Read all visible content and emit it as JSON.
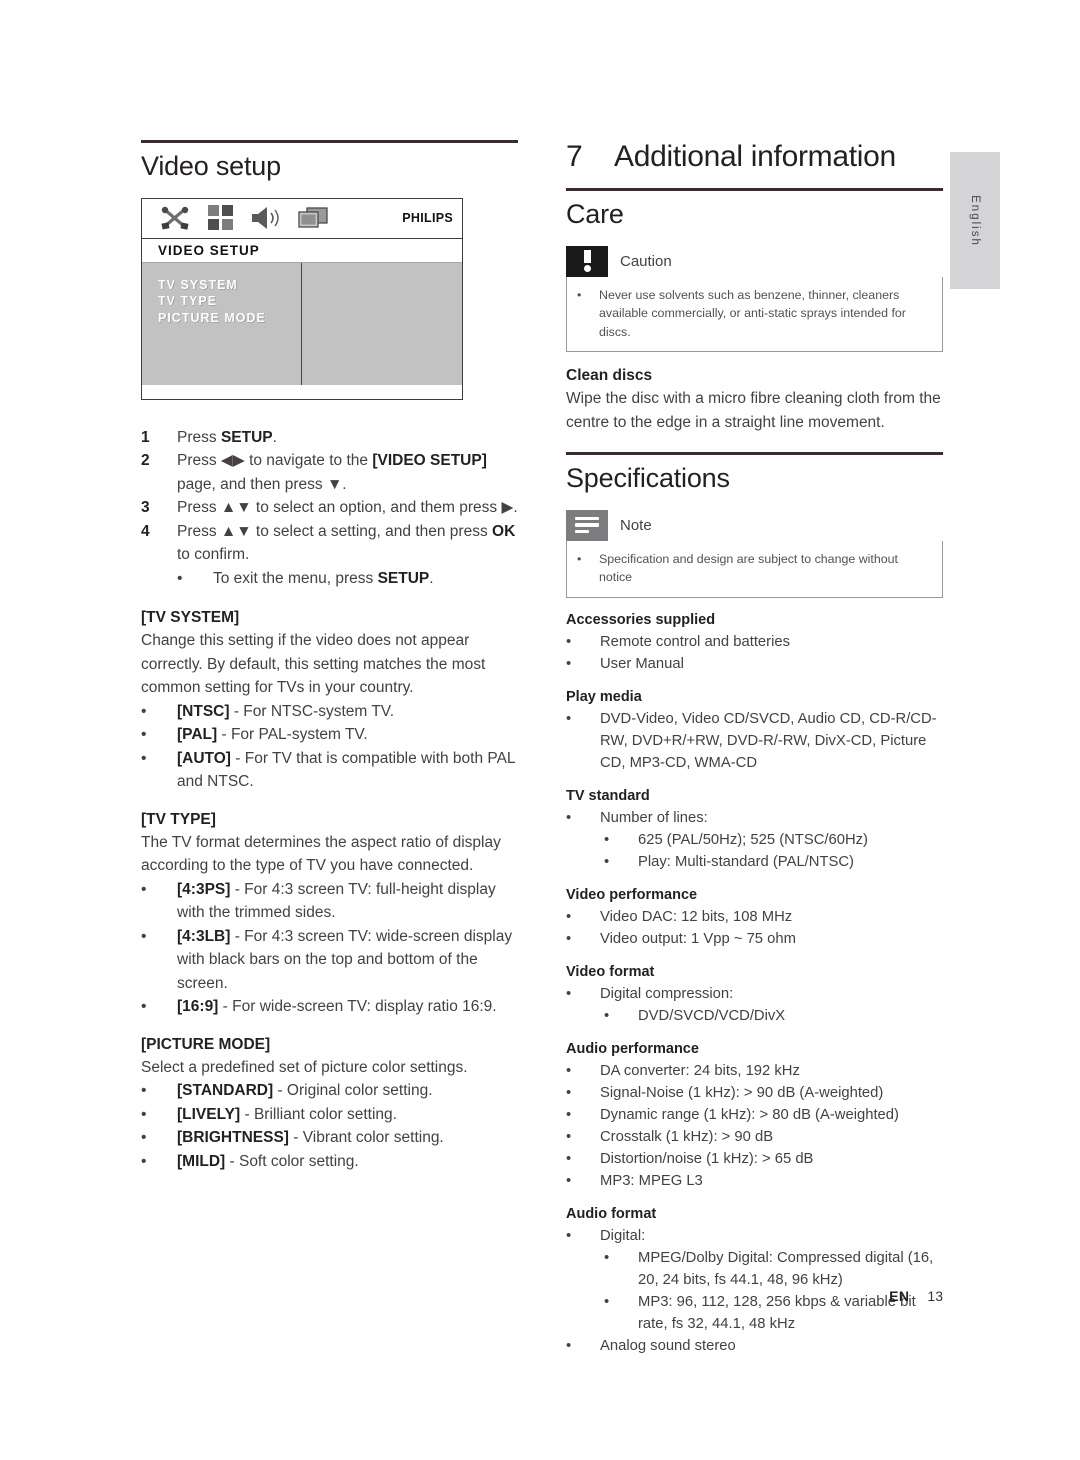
{
  "language_tab": "English",
  "footer": {
    "locale": "EN",
    "page_number": "13"
  },
  "left_column": {
    "section_title": "Video setup",
    "osd": {
      "brand": "PHILIPS",
      "title": "VIDEO SETUP",
      "icons": [
        "tools-icon",
        "grid-icon",
        "speaker-icon",
        "tv-video-icon"
      ],
      "menu_items": [
        "TV SYSTEM",
        "TV TYPE",
        "PICTURE MODE"
      ]
    },
    "steps": [
      {
        "num": "1",
        "text_parts": [
          {
            "t": "Press ",
            "b": false
          },
          {
            "t": "SETUP",
            "b": true
          },
          {
            "t": ".",
            "b": false
          }
        ]
      },
      {
        "num": "2",
        "text_parts": [
          {
            "t": "Press ◀▶ to navigate to the ",
            "b": false
          },
          {
            "t": "[VIDEO SETUP]",
            "b": true
          },
          {
            "t": " page, and then press ▼.",
            "b": false
          }
        ]
      },
      {
        "num": "3",
        "text_parts": [
          {
            "t": "Press ▲▼ to select an option, and them press ▶.",
            "b": false
          }
        ]
      },
      {
        "num": "4",
        "text_parts": [
          {
            "t": "Press ▲▼ to select a setting, and then press ",
            "b": false
          },
          {
            "t": "OK",
            "b": true
          },
          {
            "t": " to confirm.",
            "b": false
          }
        ]
      }
    ],
    "step_sub_bullet": {
      "bullet": "•",
      "parts": [
        {
          "t": "To exit the menu, press ",
          "b": false
        },
        {
          "t": "SETUP",
          "b": true
        },
        {
          "t": ".",
          "b": false
        }
      ]
    },
    "tv_system": {
      "heading": "[TV SYSTEM]",
      "body": "Change this setting if the video does not appear correctly. By default, this setting matches the most common setting for TVs in your country.",
      "items": [
        {
          "key": "[NTSC]",
          "desc": " - For NTSC-system TV."
        },
        {
          "key": "[PAL]",
          "desc": " - For PAL-system TV."
        },
        {
          "key": "[AUTO]",
          "desc": " - For TV that is compatible with both PAL and NTSC."
        }
      ]
    },
    "tv_type": {
      "heading": "[TV TYPE]",
      "body": "The TV format determines the aspect ratio of display according to the type of TV you have connected.",
      "items": [
        {
          "key": "[4:3PS]",
          "desc": " - For 4:3 screen TV: full-height display with the trimmed sides."
        },
        {
          "key": "[4:3LB]",
          "desc": " - For 4:3 screen TV: wide-screen display with black bars on the top and bottom of the screen."
        },
        {
          "key": "[16:9]",
          "desc": " - For wide-screen TV: display ratio 16:9."
        }
      ]
    },
    "picture_mode": {
      "heading": "[PICTURE MODE]",
      "body": "Select a predefined set of picture color settings.",
      "items": [
        {
          "key": "[STANDARD]",
          "desc": " - Original color setting."
        },
        {
          "key": "[LIVELY]",
          "desc": " - Brilliant color setting."
        },
        {
          "key": "[BRIGHTNESS]",
          "desc": " - Vibrant color setting."
        },
        {
          "key": "[MILD]",
          "desc": " - Soft color setting."
        }
      ]
    }
  },
  "right_column": {
    "chapter_number": "7",
    "chapter_title": "Additional information",
    "care": {
      "title": "Care",
      "caution": {
        "label": "Caution",
        "icon": "exclamation-icon",
        "items": [
          "Never use solvents such as benzene, thinner, cleaners available commercially, or anti-static sprays intended for discs."
        ]
      },
      "clean_discs": {
        "heading": "Clean discs",
        "body": "Wipe the disc with a micro fibre cleaning cloth from the centre to the edge in a straight line movement."
      }
    },
    "specifications": {
      "title": "Specifications",
      "note": {
        "label": "Note",
        "icon": "note-lines-icon",
        "items": [
          "Specification and design are subject to change without notice"
        ]
      },
      "groups": [
        {
          "heading": "Accessories supplied",
          "items": [
            {
              "level": 1,
              "text": "Remote control and batteries"
            },
            {
              "level": 1,
              "text": "User Manual"
            }
          ]
        },
        {
          "heading": "Play media",
          "items": [
            {
              "level": 1,
              "text": "DVD-Video, Video CD/SVCD, Audio CD, CD-R/CD-RW, DVD+R/+RW, DVD-R/-RW, DivX-CD, Picture CD, MP3-CD, WMA-CD"
            }
          ]
        },
        {
          "heading": "TV standard",
          "items": [
            {
              "level": 1,
              "text": "Number of lines:"
            },
            {
              "level": 2,
              "text": "625 (PAL/50Hz); 525 (NTSC/60Hz)"
            },
            {
              "level": 2,
              "text": "Play: Multi-standard (PAL/NTSC)"
            }
          ]
        },
        {
          "heading": "Video performance",
          "items": [
            {
              "level": 1,
              "text": "Video DAC: 12 bits, 108 MHz"
            },
            {
              "level": 1,
              "text": "Video output: 1 Vpp ~ 75 ohm"
            }
          ]
        },
        {
          "heading": "Video format",
          "items": [
            {
              "level": 1,
              "text": "Digital compression:"
            },
            {
              "level": 2,
              "text": "DVD/SVCD/VCD/DivX"
            }
          ]
        },
        {
          "heading": "Audio performance",
          "items": [
            {
              "level": 1,
              "text": "DA converter: 24 bits, 192 kHz"
            },
            {
              "level": 1,
              "text": "Signal-Noise (1 kHz): > 90 dB (A-weighted)"
            },
            {
              "level": 1,
              "text": "Dynamic range (1 kHz): > 80 dB (A-weighted)"
            },
            {
              "level": 1,
              "text": "Crosstalk (1 kHz): > 90 dB"
            },
            {
              "level": 1,
              "text": "Distortion/noise (1 kHz): > 65 dB"
            },
            {
              "level": 1,
              "text": "MP3: MPEG L3"
            }
          ]
        },
        {
          "heading": "Audio format",
          "items": [
            {
              "level": 1,
              "text": "Digital:"
            },
            {
              "level": 2,
              "text": "MPEG/Dolby Digital: Compressed digital (16, 20, 24 bits, fs 44.1, 48, 96 kHz)"
            },
            {
              "level": 2,
              "text": "MP3: 96, 112, 128, 256 kbps & variable bit rate, fs 32, 44.1, 48 kHz"
            },
            {
              "level": 1,
              "text": "Analog sound stereo"
            }
          ]
        }
      ]
    }
  },
  "bullet_glyph": "•"
}
